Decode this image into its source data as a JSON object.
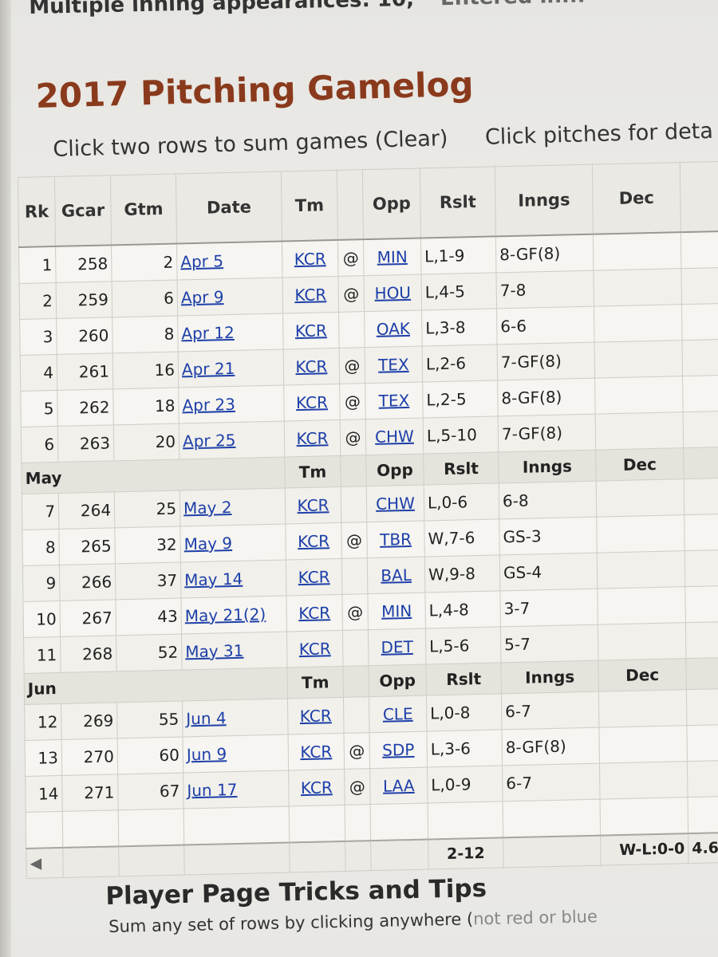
{
  "top_note": {
    "line1": "Multiple inning appearances: 10,",
    "line2": "Entered in..."
  },
  "section": {
    "title": "2017 Pitching Gamelog",
    "instruction_left_prefix": "Click two rows to sum games (",
    "instruction_clear": "Clear",
    "instruction_left_suffix": ")",
    "instruction_right": "Click pitches for deta"
  },
  "table": {
    "headers": [
      "Rk",
      "Gcar",
      "Gtm",
      "Date",
      "Tm",
      "",
      "Opp",
      "Rslt",
      "Inngs",
      "Dec"
    ],
    "groups": [
      {
        "label": "",
        "rows": [
          {
            "rk": "1",
            "gcar": "258",
            "gtm": "2",
            "date": "Apr 5",
            "tm": "KCR",
            "at": "@",
            "opp": "MIN",
            "rslt": "L,1-9",
            "inngs": "8-GF(8)",
            "dec": ""
          },
          {
            "rk": "2",
            "gcar": "259",
            "gtm": "6",
            "date": "Apr 9",
            "tm": "KCR",
            "at": "@",
            "opp": "HOU",
            "rslt": "L,4-5",
            "inngs": "7-8",
            "dec": ""
          },
          {
            "rk": "3",
            "gcar": "260",
            "gtm": "8",
            "date": "Apr 12",
            "tm": "KCR",
            "at": "",
            "opp": "OAK",
            "rslt": "L,3-8",
            "inngs": "6-6",
            "dec": ""
          },
          {
            "rk": "4",
            "gcar": "261",
            "gtm": "16",
            "date": "Apr 21",
            "tm": "KCR",
            "at": "@",
            "opp": "TEX",
            "rslt": "L,2-6",
            "inngs": "7-GF(8)",
            "dec": ""
          },
          {
            "rk": "5",
            "gcar": "262",
            "gtm": "18",
            "date": "Apr 23",
            "tm": "KCR",
            "at": "@",
            "opp": "TEX",
            "rslt": "L,2-5",
            "inngs": "8-GF(8)",
            "dec": ""
          },
          {
            "rk": "6",
            "gcar": "263",
            "gtm": "20",
            "date": "Apr 25",
            "tm": "KCR",
            "at": "@",
            "opp": "CHW",
            "rslt": "L,5-10",
            "inngs": "7-GF(8)",
            "dec": ""
          }
        ]
      },
      {
        "label": "May",
        "sub_headers": {
          "tm": "Tm",
          "opp": "Opp",
          "rslt": "Rslt",
          "inngs": "Inngs",
          "dec": "Dec"
        },
        "rows": [
          {
            "rk": "7",
            "gcar": "264",
            "gtm": "25",
            "date": "May 2",
            "tm": "KCR",
            "at": "",
            "opp": "CHW",
            "rslt": "L,0-6",
            "inngs": "6-8",
            "dec": ""
          },
          {
            "rk": "8",
            "gcar": "265",
            "gtm": "32",
            "date": "May 9",
            "tm": "KCR",
            "at": "@",
            "opp": "TBR",
            "rslt": "W,7-6",
            "inngs": "GS-3",
            "dec": ""
          },
          {
            "rk": "9",
            "gcar": "266",
            "gtm": "37",
            "date": "May 14",
            "tm": "KCR",
            "at": "",
            "opp": "BAL",
            "rslt": "W,9-8",
            "inngs": "GS-4",
            "dec": ""
          },
          {
            "rk": "10",
            "gcar": "267",
            "gtm": "43",
            "date": "May 21(2)",
            "tm": "KCR",
            "at": "@",
            "opp": "MIN",
            "rslt": "L,4-8",
            "inngs": "3-7",
            "dec": ""
          },
          {
            "rk": "11",
            "gcar": "268",
            "gtm": "52",
            "date": "May 31",
            "tm": "KCR",
            "at": "",
            "opp": "DET",
            "rslt": "L,5-6",
            "inngs": "5-7",
            "dec": ""
          }
        ]
      },
      {
        "label": "Jun",
        "sub_headers": {
          "tm": "Tm",
          "opp": "Opp",
          "rslt": "Rslt",
          "inngs": "Inngs",
          "dec": "Dec"
        },
        "rows": [
          {
            "rk": "12",
            "gcar": "269",
            "gtm": "55",
            "date": "Jun 4",
            "tm": "KCR",
            "at": "",
            "opp": "CLE",
            "rslt": "L,0-8",
            "inngs": "6-7",
            "dec": ""
          },
          {
            "rk": "13",
            "gcar": "270",
            "gtm": "60",
            "date": "Jun 9",
            "tm": "KCR",
            "at": "@",
            "opp": "SDP",
            "rslt": "L,3-6",
            "inngs": "8-GF(8)",
            "dec": ""
          },
          {
            "rk": "14",
            "gcar": "271",
            "gtm": "67",
            "date": "Jun 17",
            "tm": "KCR",
            "at": "@",
            "opp": "LAA",
            "rslt": "L,0-9",
            "inngs": "6-7",
            "dec": ""
          }
        ]
      }
    ],
    "footer": {
      "rslt": "2-12",
      "dec": "W-L:0-0",
      "extra": "4.6"
    },
    "scroll_icon": "scroll-left-arrow"
  },
  "tips": {
    "title": "Player Page Tricks and Tips",
    "text": "Sum any set of rows by clicking anywhere (",
    "text_muted": "not red or blue"
  }
}
